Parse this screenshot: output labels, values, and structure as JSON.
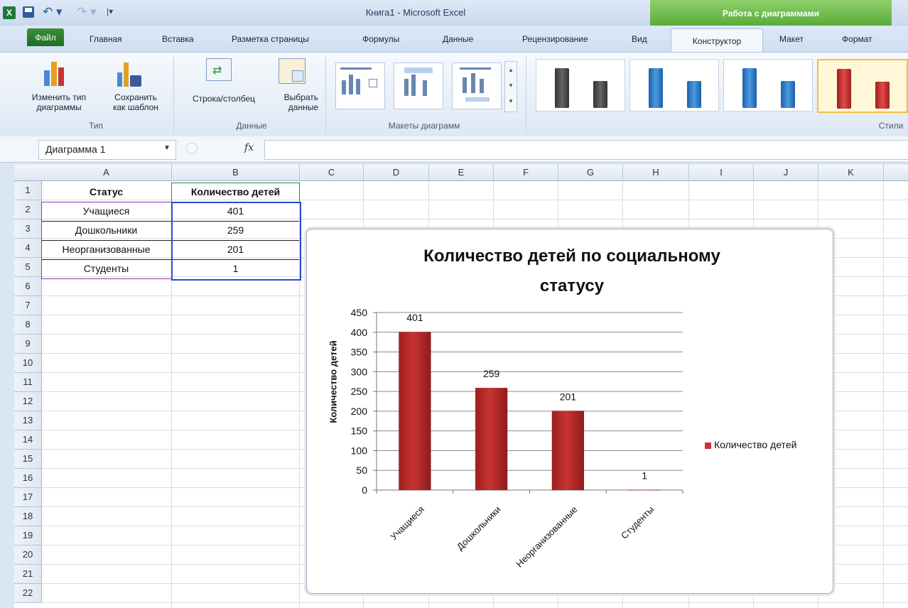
{
  "titlebar": {
    "window_title": "Книга1 - Microsoft Excel",
    "context_group": "Работа с диаграммами",
    "excel_logo": "X"
  },
  "tabs": [
    "Файл",
    "Главная",
    "Вставка",
    "Разметка страницы",
    "Формулы",
    "Данные",
    "Рецензирование",
    "Вид",
    "Конструктор",
    "Макет",
    "Формат"
  ],
  "ribbon": {
    "change_type": "Изменить тип диаграммы",
    "change_type_l1": "Изменить тип",
    "change_type_l2": "диаграммы",
    "save_template_l1": "Сохранить",
    "save_template_l2": "как шаблон",
    "group_type": "Тип",
    "switch_rowcol": "Строка/столбец",
    "select_data_l1": "Выбрать",
    "select_data_l2": "данные",
    "group_data": "Данные",
    "group_layouts": "Макеты диаграмм",
    "group_styles": "Стили"
  },
  "formula_bar": {
    "name_box": "Диаграмма 1",
    "fx": "fx"
  },
  "columns": [
    "A",
    "B",
    "C",
    "D",
    "E",
    "F",
    "G",
    "H",
    "I",
    "J",
    "K"
  ],
  "rows": [
    "1",
    "2",
    "3",
    "4",
    "5",
    "6",
    "7",
    "8",
    "9",
    "10",
    "11",
    "12",
    "13",
    "14",
    "15",
    "16",
    "17",
    "18",
    "19",
    "20",
    "21",
    "22"
  ],
  "table": {
    "headers": [
      "Статус",
      "Количество детей"
    ],
    "rows": [
      [
        "Учащиеся",
        "401"
      ],
      [
        "Дошкольники",
        "259"
      ],
      [
        "Неорганизованные",
        "201"
      ],
      [
        "Студенты",
        "1"
      ]
    ]
  },
  "chart_data": {
    "type": "bar",
    "title": "Количество детей по социальному статусу",
    "title_l1": "Количество детей по социальному",
    "title_l2": "статусу",
    "categories": [
      "Учащиеся",
      "Дошкольники",
      "Неорганизованные",
      "Студенты"
    ],
    "series": [
      {
        "name": "Количество детей",
        "values": [
          401,
          259,
          201,
          1
        ]
      }
    ],
    "ylabel": "Количество  детей",
    "ylim": [
      0,
      450
    ],
    "yticks": [
      0,
      50,
      100,
      150,
      200,
      250,
      300,
      350,
      400,
      450
    ],
    "grid": true,
    "legend": "right",
    "bar_color": "#c93232"
  }
}
